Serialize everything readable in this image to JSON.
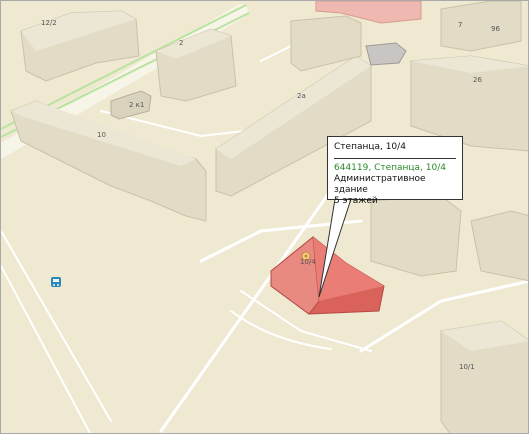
{
  "map": {
    "popup": {
      "title": "Степанца, 10/4",
      "link_text": "644119, Степанца, 10/4",
      "description_line1": "Административное здание",
      "description_line2": "5 этажей"
    },
    "building_labels": {
      "b12_2": "12/2",
      "b2": "2",
      "b2k1": "2 к1",
      "b2a": "2а",
      "b10": "10",
      "b7": "7",
      "b96": "96",
      "b26": "26",
      "b10_4": "10/4",
      "b10_1": "10/1"
    },
    "icons": {
      "bus_stop": "bus-stop-icon",
      "building_marker": "building-marker-icon"
    },
    "colors": {
      "ground": "#efe9d2",
      "road": "#f6f3e6",
      "building": "#ddd7c0",
      "selected_building": "#e07a72",
      "green_line": "#b9e3a0"
    }
  }
}
